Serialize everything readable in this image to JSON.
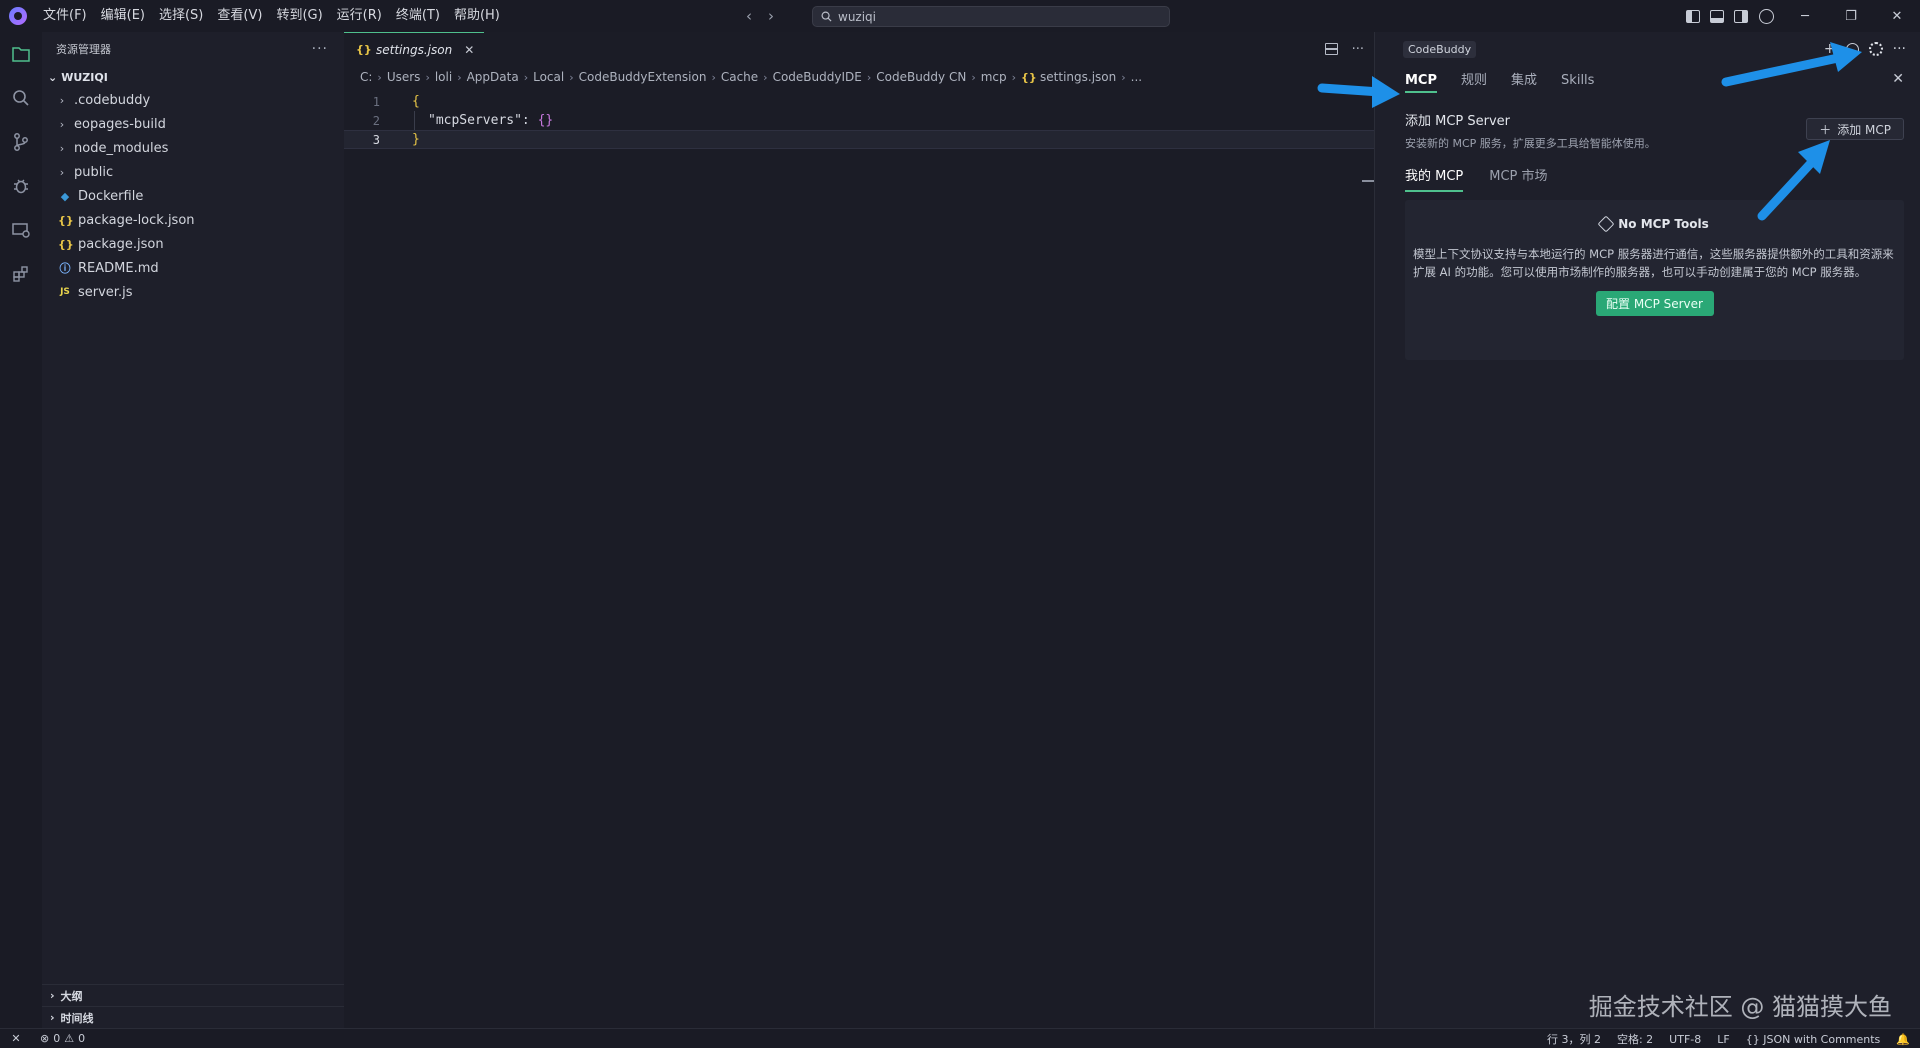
{
  "menu": [
    "文件(F)",
    "编辑(E)",
    "选择(S)",
    "查看(V)",
    "转到(G)",
    "运行(R)",
    "终端(T)",
    "帮助(H)"
  ],
  "search": {
    "value": "wuziqi"
  },
  "sidebar": {
    "title": "资源管理器",
    "root": "WUZIQI",
    "items": [
      {
        "label": ".codebuddy",
        "type": "folder"
      },
      {
        "label": "eopages-build",
        "type": "folder"
      },
      {
        "label": "node_modules",
        "type": "folder"
      },
      {
        "label": "public",
        "type": "folder"
      },
      {
        "label": "Dockerfile",
        "type": "docker"
      },
      {
        "label": "package-lock.json",
        "type": "json"
      },
      {
        "label": "package.json",
        "type": "json"
      },
      {
        "label": "README.md",
        "type": "info"
      },
      {
        "label": "server.js",
        "type": "js"
      }
    ],
    "outline": "大纲",
    "timeline": "时间线"
  },
  "editor": {
    "tab": "settings.json",
    "breadcrumbs": [
      "C:",
      "Users",
      "loli",
      "AppData",
      "Local",
      "CodeBuddyExtension",
      "Cache",
      "CodeBuddyIDE",
      "CodeBuddy CN",
      "mcp",
      "settings.json",
      "..."
    ],
    "lines": [
      "1",
      "2",
      "3"
    ],
    "code": {
      "open": "{",
      "key": "\"mcpServers\"",
      "colon": ": ",
      "value": "{}",
      "close": "}"
    }
  },
  "panel": {
    "badge": "CodeBuddy",
    "tabs": [
      "MCP",
      "规则",
      "集成",
      "Skills"
    ],
    "add_title": "添加 MCP Server",
    "add_desc": "安装新的 MCP 服务，扩展更多工具给智能体使用。",
    "add_button": "添加 MCP",
    "subtabs": [
      "我的 MCP",
      "MCP 市场"
    ],
    "empty_title": "No MCP Tools",
    "empty_desc": "模型上下文协议支持与本地运行的 MCP 服务器进行通信，这些服务器提供额外的工具和资源来扩展 AI 的功能。您可以使用市场制作的服务器，也可以手动创建属于您的 MCP 服务器。",
    "config_button": "配置 MCP Server"
  },
  "watermark": "掘金技术社区 @ 猫猫摸大鱼",
  "status": {
    "errors": "0",
    "warnings": "0",
    "position": "行 3，列 2",
    "spaces": "空格: 2",
    "encoding": "UTF-8",
    "eol": "LF",
    "language": "JSON with Comments"
  },
  "colors": {
    "accent": "#4fc08d",
    "arrow": "#1e90e8",
    "button": "#2aa876"
  }
}
